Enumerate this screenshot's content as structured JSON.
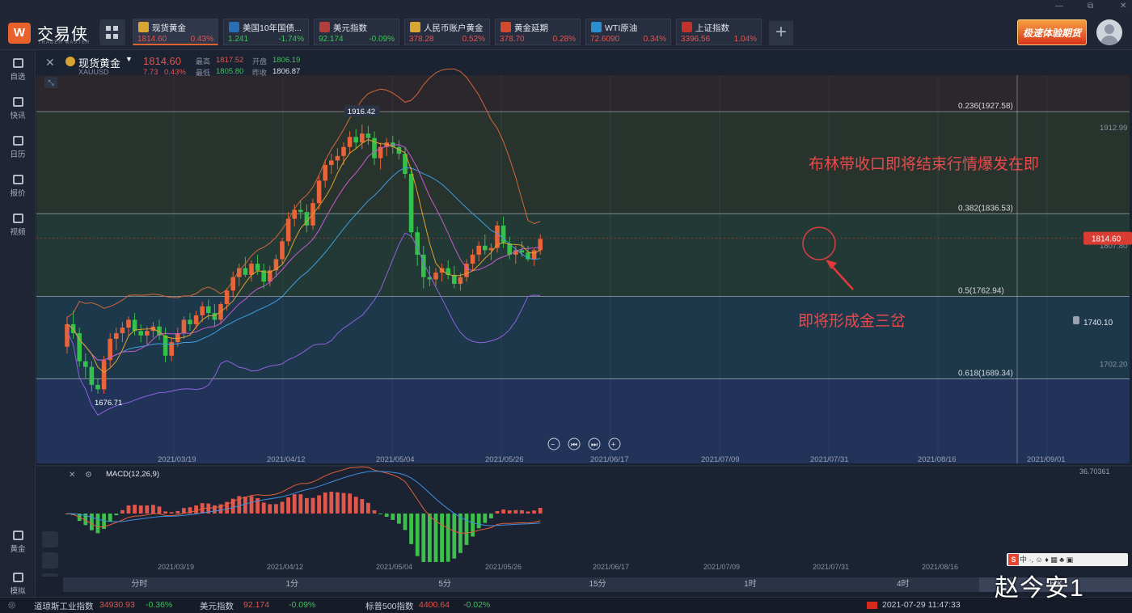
{
  "app": {
    "name": "交易侠",
    "subtitle": "TRADER MASTER",
    "logo_glyph": "W"
  },
  "window_controls": [
    "—",
    "⧉",
    "✕"
  ],
  "tabs": [
    {
      "name": "现货黄金",
      "price": "1814.60",
      "change": "0.43%",
      "dir": "up",
      "icon": "gold-coin",
      "icon_color": "#d9a531"
    },
    {
      "name": "美国10年国债...",
      "price": "1.241",
      "change": "-1.74%",
      "dir": "dn",
      "icon": "bar-chart",
      "icon_color": "#2a6fb5"
    },
    {
      "name": "美元指数",
      "price": "92.174",
      "change": "-0.09%",
      "dir": "dn",
      "icon": "us-flag",
      "icon_color": "#b33c3c"
    },
    {
      "name": "人民币账户黄金",
      "price": "378.28",
      "change": "0.52%",
      "dir": "up",
      "icon": "gold-coin",
      "icon_color": "#d9a531"
    },
    {
      "name": "黄金延期",
      "price": "378.70",
      "change": "0.28%",
      "dir": "up",
      "icon": "gold-bar",
      "icon_color": "#d24a2d"
    },
    {
      "name": "WTI原油",
      "price": "72.6090",
      "change": "0.34%",
      "dir": "up",
      "icon": "oil-drop",
      "icon_color": "#2a8fcf"
    },
    {
      "name": "上证指数",
      "price": "3396.56",
      "change": "1.04%",
      "dir": "up",
      "icon": "sse-logo",
      "icon_color": "#c0322b"
    }
  ],
  "add_tab": "+",
  "promo": "极速体验期货",
  "sidebar": [
    {
      "label": "自选",
      "icon": "bookmark-icon"
    },
    {
      "label": "快讯",
      "icon": "news-icon"
    },
    {
      "label": "日历",
      "icon": "calendar-icon"
    },
    {
      "label": "报价",
      "icon": "quote-icon"
    },
    {
      "label": "视频",
      "icon": "video-icon"
    },
    {
      "label": "黄金",
      "icon": "gold-icon"
    },
    {
      "label": "模拟",
      "icon": "wallet-icon"
    }
  ],
  "symbol": {
    "name": "现货黄金",
    "code": "XAUUSD",
    "price": "1814.60",
    "change": "7.73",
    "change_pct": "0.43%",
    "high_label": "最高",
    "high": "1817.52",
    "open_label": "开盘",
    "open": "1806.19",
    "low_label": "最低",
    "low": "1805.80",
    "prev_label": "昨收",
    "prev": "1806.87"
  },
  "fib": [
    {
      "label": "0.236(1927.58)",
      "value": 1927.58
    },
    {
      "label": "0.382(1836.53)",
      "value": 1836.53
    },
    {
      "label": "0.5(1762.94)",
      "value": 1762.94
    },
    {
      "label": "0.618(1689.34)",
      "value": 1689.34
    }
  ],
  "price_axis": {
    "labels": [
      "1912.99",
      "1807.80",
      "1702.20"
    ],
    "current": "1814.60",
    "alert": "1740.10"
  },
  "markers": {
    "high": "1916.42",
    "low": "1676.71"
  },
  "annotations": {
    "top": "布林带收口即将结束行情爆发在即",
    "bottom": "即将形成金三岔"
  },
  "x_dates": [
    "2021/03/19",
    "2021/04/12",
    "2021/05/04",
    "2021/05/26",
    "2021/06/17",
    "2021/07/09",
    "2021/07/31",
    "2021/08/16",
    "2021/09/01"
  ],
  "x_dates_macd": [
    "2021/03/19",
    "2021/04/12",
    "2021/05/04",
    "2021/05/26",
    "2021/06/17",
    "2021/07/09",
    "2021/07/31",
    "2021/08/16"
  ],
  "nav_buttons": [
    "−",
    "⏮",
    "⏭",
    "+"
  ],
  "macd": {
    "label": "MACD(12,26,9)",
    "top_value": "36.70361"
  },
  "timeframes": [
    "分时",
    "1分",
    "5分",
    "15分",
    "1时",
    "4时",
    "日K"
  ],
  "timeframe_selected": "日K",
  "status": {
    "items": [
      {
        "name": "道琼斯工业指数",
        "value": "34930.93",
        "change": "-0.36%"
      },
      {
        "name": "美元指数",
        "value": "92.174",
        "change": "-0.09%"
      },
      {
        "name": "标普500指数",
        "value": "4400.64",
        "change": "-0.02%"
      }
    ],
    "datetime": "2021-07-29 11:47:33"
  },
  "watermark": "赵今安1",
  "watermark_bar": "中 ·, ☺ ♦ ▦ ♣ ▣",
  "chart_data": {
    "type": "candlestick",
    "title": "现货黄金 XAUUSD",
    "x_range": [
      "2021/03/08",
      "2021/07/29"
    ],
    "ylim": [
      1650,
      1960
    ],
    "candles": [
      [
        1718,
        1745,
        1712,
        1738
      ],
      [
        1738,
        1750,
        1725,
        1730
      ],
      [
        1730,
        1735,
        1700,
        1705
      ],
      [
        1705,
        1712,
        1690,
        1700
      ],
      [
        1700,
        1705,
        1678,
        1684
      ],
      [
        1684,
        1690,
        1676,
        1680
      ],
      [
        1680,
        1710,
        1676,
        1706
      ],
      [
        1706,
        1730,
        1700,
        1725
      ],
      [
        1725,
        1735,
        1715,
        1730
      ],
      [
        1730,
        1740,
        1722,
        1735
      ],
      [
        1735,
        1745,
        1728,
        1742
      ],
      [
        1742,
        1748,
        1728,
        1732
      ],
      [
        1732,
        1738,
        1722,
        1728
      ],
      [
        1728,
        1736,
        1720,
        1732
      ],
      [
        1732,
        1740,
        1726,
        1736
      ],
      [
        1736,
        1742,
        1724,
        1728
      ],
      [
        1728,
        1735,
        1704,
        1710
      ],
      [
        1710,
        1726,
        1705,
        1722
      ],
      [
        1722,
        1735,
        1718,
        1730
      ],
      [
        1730,
        1745,
        1725,
        1742
      ],
      [
        1742,
        1748,
        1732,
        1738
      ],
      [
        1738,
        1750,
        1734,
        1746
      ],
      [
        1746,
        1758,
        1740,
        1754
      ],
      [
        1754,
        1760,
        1742,
        1748
      ],
      [
        1748,
        1756,
        1736,
        1742
      ],
      [
        1742,
        1758,
        1738,
        1756
      ],
      [
        1756,
        1770,
        1750,
        1768
      ],
      [
        1768,
        1785,
        1762,
        1780
      ],
      [
        1780,
        1792,
        1772,
        1788
      ],
      [
        1788,
        1798,
        1780,
        1782
      ],
      [
        1782,
        1795,
        1776,
        1792
      ],
      [
        1792,
        1800,
        1782,
        1786
      ],
      [
        1786,
        1792,
        1770,
        1776
      ],
      [
        1776,
        1790,
        1772,
        1786
      ],
      [
        1786,
        1800,
        1780,
        1796
      ],
      [
        1796,
        1815,
        1792,
        1812
      ],
      [
        1812,
        1838,
        1808,
        1832
      ],
      [
        1832,
        1845,
        1825,
        1840
      ],
      [
        1840,
        1848,
        1832,
        1838
      ],
      [
        1838,
        1845,
        1820,
        1826
      ],
      [
        1826,
        1850,
        1822,
        1846
      ],
      [
        1846,
        1870,
        1840,
        1866
      ],
      [
        1866,
        1885,
        1860,
        1880
      ],
      [
        1880,
        1890,
        1872,
        1884
      ],
      [
        1884,
        1895,
        1876,
        1888
      ],
      [
        1888,
        1900,
        1880,
        1896
      ],
      [
        1896,
        1910,
        1890,
        1905
      ],
      [
        1905,
        1912,
        1895,
        1900
      ],
      [
        1900,
        1916,
        1894,
        1908
      ],
      [
        1908,
        1915,
        1898,
        1904
      ],
      [
        1904,
        1910,
        1880,
        1886
      ],
      [
        1886,
        1900,
        1876,
        1896
      ],
      [
        1896,
        1904,
        1888,
        1900
      ],
      [
        1900,
        1906,
        1890,
        1896
      ],
      [
        1896,
        1902,
        1885,
        1890
      ],
      [
        1890,
        1896,
        1868,
        1872
      ],
      [
        1872,
        1878,
        1815,
        1820
      ],
      [
        1820,
        1825,
        1790,
        1800
      ],
      [
        1800,
        1808,
        1770,
        1780
      ],
      [
        1780,
        1790,
        1772,
        1778
      ],
      [
        1778,
        1788,
        1772,
        1784
      ],
      [
        1784,
        1792,
        1776,
        1788
      ],
      [
        1788,
        1795,
        1778,
        1782
      ],
      [
        1782,
        1790,
        1770,
        1774
      ],
      [
        1774,
        1784,
        1768,
        1780
      ],
      [
        1780,
        1796,
        1776,
        1792
      ],
      [
        1792,
        1805,
        1786,
        1800
      ],
      [
        1800,
        1812,
        1794,
        1808
      ],
      [
        1808,
        1818,
        1800,
        1804
      ],
      [
        1804,
        1810,
        1795,
        1806
      ],
      [
        1806,
        1830,
        1802,
        1826
      ],
      [
        1826,
        1834,
        1806,
        1810
      ],
      [
        1810,
        1816,
        1796,
        1800
      ],
      [
        1800,
        1808,
        1792,
        1804
      ],
      [
        1804,
        1812,
        1798,
        1802
      ],
      [
        1802,
        1808,
        1794,
        1796
      ],
      [
        1796,
        1806,
        1790,
        1804
      ],
      [
        1804,
        1818,
        1800,
        1814
      ]
    ]
  }
}
